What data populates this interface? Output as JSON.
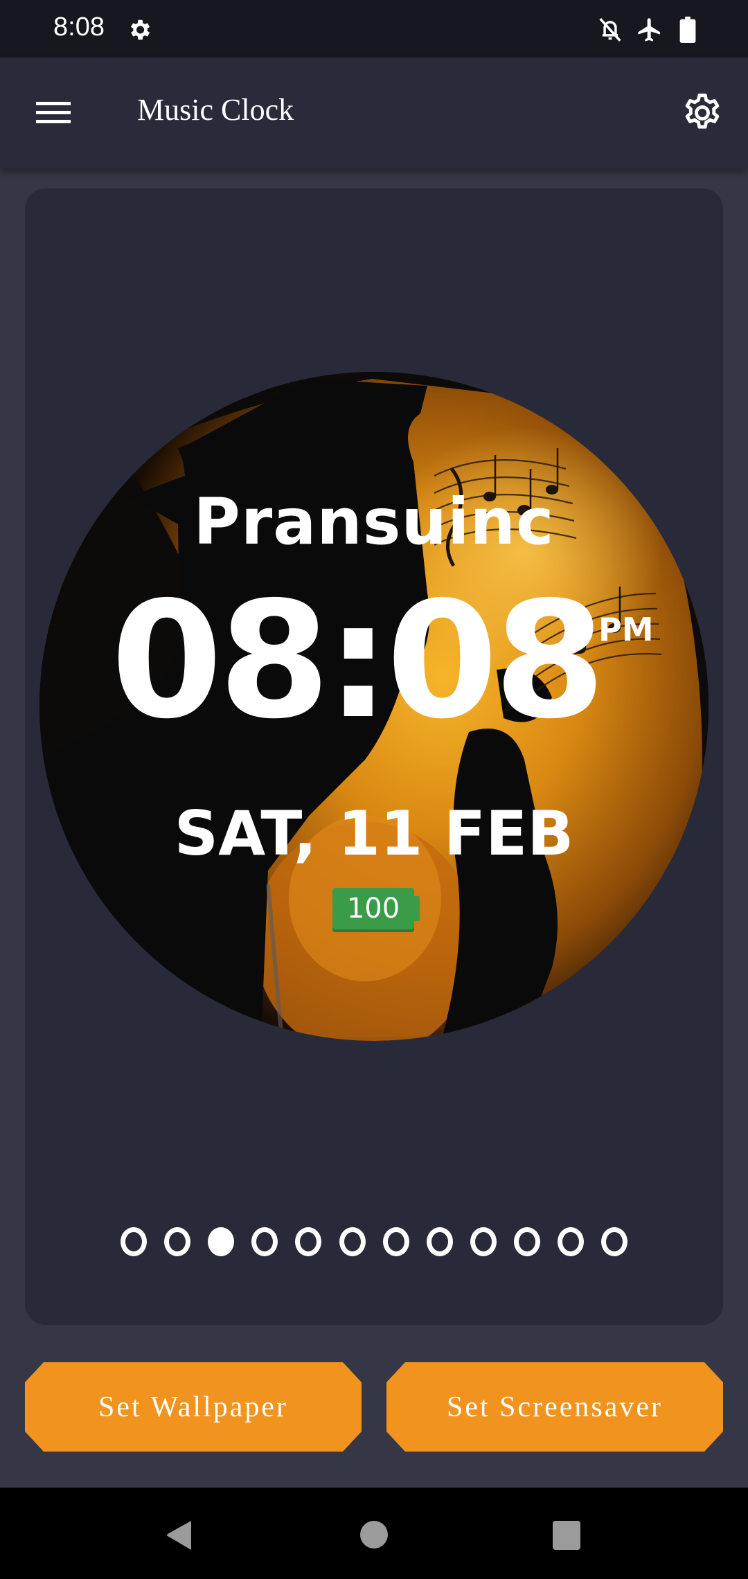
{
  "status_bar": {
    "time": "8:08",
    "icons": [
      "settings-icon",
      "notifications-off-icon",
      "airplane-mode-icon",
      "battery-full-icon"
    ]
  },
  "app_bar": {
    "title": "Music Clock",
    "menu_icon": "hamburger-menu-icon",
    "settings_icon": "gear-icon"
  },
  "clock_preview": {
    "brand": "Pransuinc",
    "time": "08:08",
    "ampm": "PM",
    "date": "SAT, 11 FEB",
    "battery_level": "100",
    "battery_color": "#3a9b48",
    "background_theme": "saxophone-player-silhouette-music-notes"
  },
  "pager": {
    "total_pages": 12,
    "active_index": 2
  },
  "actions": {
    "set_wallpaper": "Set Wallpaper",
    "set_screensaver": "Set Screensaver",
    "accent_color": "#f0931f"
  },
  "nav_bar": {
    "icons": [
      "back-icon",
      "home-icon",
      "recents-icon"
    ]
  }
}
